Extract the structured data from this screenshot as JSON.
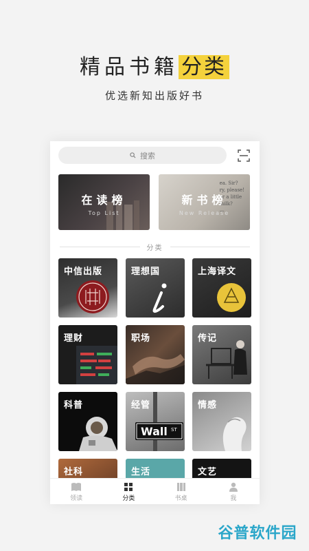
{
  "headline": {
    "main": "精品书籍",
    "highlight": "分类"
  },
  "subline": "优选新知出版好书",
  "search": {
    "placeholder": "搜索"
  },
  "banners": [
    {
      "title": "在读榜",
      "subtitle": "Top List"
    },
    {
      "title": "新书榜",
      "subtitle": "New Release"
    }
  ],
  "section_label": "分类",
  "categories": [
    {
      "label": "中信出版"
    },
    {
      "label": "理想国"
    },
    {
      "label": "上海译文"
    },
    {
      "label": "理财"
    },
    {
      "label": "职场"
    },
    {
      "label": "传记"
    },
    {
      "label": "科普"
    },
    {
      "label": "经管"
    },
    {
      "label": "情感"
    },
    {
      "label": "社科"
    },
    {
      "label": "生活"
    },
    {
      "label": "文艺"
    }
  ],
  "wall_sign": {
    "word": "Wall",
    "suffix": "ST"
  },
  "tabs": [
    {
      "label": "领读",
      "icon": "book-read-icon"
    },
    {
      "label": "分类",
      "icon": "grid-icon"
    },
    {
      "label": "书桌",
      "icon": "bookshelf-icon"
    },
    {
      "label": "我",
      "icon": "person-icon"
    }
  ],
  "watermark": "谷普软件园",
  "colors": {
    "highlight": "#f4d23c",
    "accent_yellow": "#e8c33a",
    "citic_red": "#8d1b1f",
    "watermark": "#2aa6c9"
  }
}
